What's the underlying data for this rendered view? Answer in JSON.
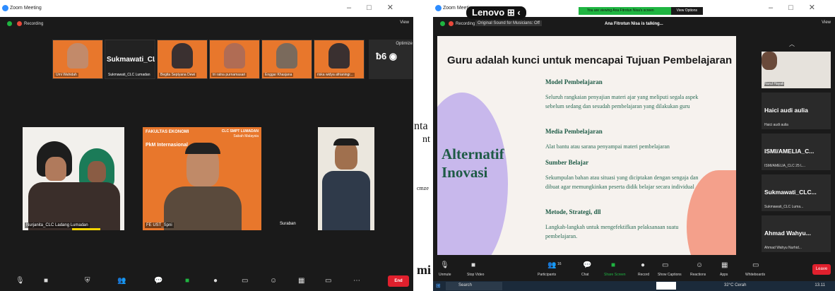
{
  "left": {
    "title": "Zoom Meeting",
    "recording": "Recording",
    "view": "View",
    "optimize": "Optimize",
    "thumbs": [
      {
        "label": "Umi Wahidah"
      },
      {
        "big": "Sukmawati_CLC...",
        "label": "Sukmawati_CLC Lumadan"
      },
      {
        "label": "Begita Septyana Dewi"
      },
      {
        "label": "tri ratna purnamasari"
      },
      {
        "label": "Enggar Khasjana"
      },
      {
        "label": "riska widya afrianingr..."
      }
    ],
    "tiles": [
      {
        "label": "Nurjanita_CLC Ladang Lumadan"
      },
      {
        "label": "FE UST_Spni",
        "logo": "FAKULTAS EKONOMI",
        "clc": "CLC SMPT LUMADAN",
        "clc2": "Sabah Malaysia",
        "pkm": "PkM Internasional"
      },
      {
        "label": "Suraban"
      }
    ],
    "end": "End"
  },
  "right": {
    "title": "Zoom Meeting",
    "recording": "Recording",
    "original_sound": "Original Sound for Musicians: Off",
    "view": "View",
    "talking": "Ana Fitrotun Nisa is talking...",
    "viewing": "You are viewing Ana Fitrotun Nisa's screen",
    "view_options": "View Options",
    "slide": {
      "title": "Guru adalah kunci untuk mencapai Tujuan Pembelajaran",
      "alt1": "Alternatif",
      "alt2": "Inovasi",
      "points": [
        {
          "h": "Model Pembelajaran",
          "p": "Seluruh rangkaian penyajian materi ajar yang meliputi segala aspek sebelum sedang dan sesudah pembelajaran yang dilakukan guru"
        },
        {
          "h": "Media Pembelajaran",
          "p": "Alat bantu atau sarana penyampai materi pembelajaran"
        },
        {
          "h": "Sumber Belajar",
          "p": "Sekumpulan bahan atau situasi yang diciptakan dengan sengaja dan dibuat agar memungkinkan peserta didik belajar secara individual"
        },
        {
          "h": "Metode, Strategi, dll",
          "p": "Langkah-langkah untuk mengefektifkan pelaksanaan suatu pembelajaran."
        }
      ]
    },
    "side": [
      {
        "name": "",
        "sub": "Nurul Hayati"
      },
      {
        "name": "Haici audi aulia",
        "sub": "Haici audi aulia"
      },
      {
        "name": "ISMI/AMELIA_C...",
        "sub": "ISMI/AMELIA_CLC 25 L..."
      },
      {
        "name": "Sukmawati_CLC...",
        "sub": "Sukmawati_CLC Luma..."
      },
      {
        "name": "Ahmad Wahyu...",
        "sub": "Ahmad Wahyu Nurhid..."
      }
    ],
    "controls": [
      "Unmute",
      "Stop Video",
      "Participants",
      "Chat",
      "Share Screen",
      "Record",
      "Show Captions",
      "Reactions",
      "Apps",
      "Whiteboards"
    ],
    "participants_count": "16",
    "leave": "Leave",
    "taskbar": {
      "search": "Search",
      "weather": "32°C Cerah",
      "time": "13.11"
    }
  },
  "overlay": {
    "lenovo": "Lenovo",
    "bg1": "nta",
    "bg2": "nt",
    "bg3": "mi",
    "bg4": "cmze"
  },
  "accent": "#1fb541"
}
